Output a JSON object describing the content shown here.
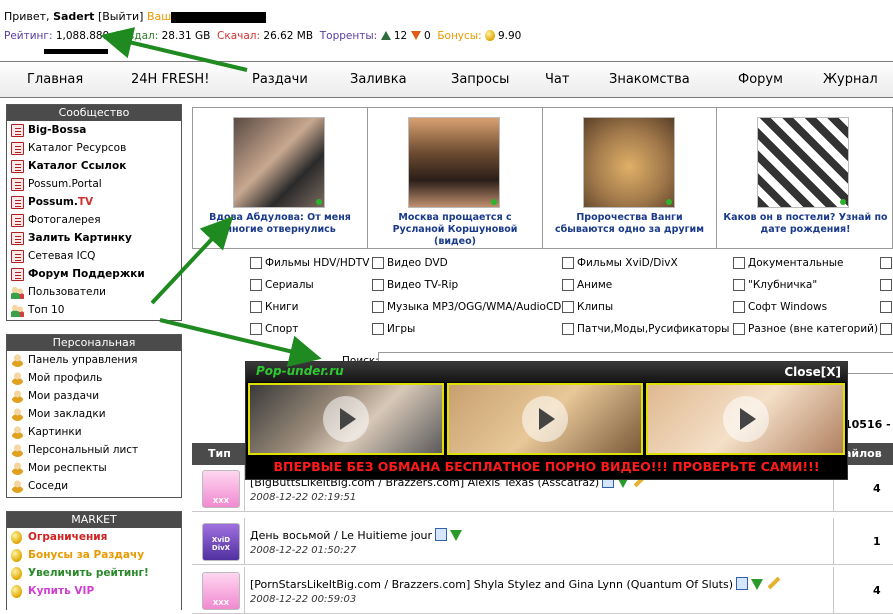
{
  "userbar": {
    "greeting": "Привет,",
    "username": "Sadert",
    "logout": "[Выйти]",
    "your_label": "Ваш",
    "rating_label": "Рейтинг:",
    "rating_value": "1,088.889",
    "upload_label": "Роздал:",
    "upload_value": "28.31 GB",
    "download_label": "Скачал:",
    "download_value": "26.62 MB",
    "torrents_label": "Торренты:",
    "seeding": "12",
    "leeching": "0",
    "bonus_label": "Бонусы:",
    "bonus_value": "9.90"
  },
  "nav": [
    {
      "label": "Главная"
    },
    {
      "label": "24H FRESH!"
    },
    {
      "label": "Раздачи"
    },
    {
      "label": "Заливка"
    },
    {
      "label": "Запросы"
    },
    {
      "label": "Чат"
    },
    {
      "label": "Знакомства"
    },
    {
      "label": "Форум"
    },
    {
      "label": "Журнал"
    }
  ],
  "community": {
    "title": "Сообщество",
    "items": [
      {
        "label": "Big-Bossa",
        "icon": "doc-icon"
      },
      {
        "label": "Каталог Ресурсов",
        "icon": "doc-icon"
      },
      {
        "label": "Каталог Ссылок",
        "icon": "doc-icon"
      },
      {
        "label": "Possum.Portal",
        "icon": "doc-icon"
      },
      {
        "label": "Possum.",
        "label_suffix": "TV",
        "icon": "doc-icon"
      },
      {
        "label": "Фотогалерея",
        "icon": "doc-icon"
      },
      {
        "label": "Залить Картинку",
        "icon": "doc-icon"
      },
      {
        "label": "Сетевая ICQ",
        "icon": "doc-icon"
      },
      {
        "label": "Форум Поддержки",
        "icon": "doc-icon"
      },
      {
        "label": "Пользователи",
        "icon": "users-icon"
      },
      {
        "label": "Топ 10",
        "icon": "users-icon"
      }
    ]
  },
  "personal": {
    "title": "Персональная",
    "items": [
      {
        "label": "Панель управления"
      },
      {
        "label": "Мой профиль"
      },
      {
        "label": "Мои раздачи"
      },
      {
        "label": "Мои закладки"
      },
      {
        "label": "Картинки"
      },
      {
        "label": "Персональный лист"
      },
      {
        "label": "Мои респекты"
      },
      {
        "label": "Соседи"
      }
    ]
  },
  "market": {
    "title": "MARKET",
    "items": [
      {
        "label": "Ограничения",
        "color": "#d02020"
      },
      {
        "label": "Бонусы за Раздачу",
        "color": "#e89a00"
      },
      {
        "label": "Увеличить рейтинг!",
        "color": "#2a8a2a"
      },
      {
        "label": "Купить VIP",
        "color": "#d040d0"
      }
    ]
  },
  "featured": [
    {
      "caption": "Вдова Абдулова: От меня многие отвернулись"
    },
    {
      "caption": "Москва прощается с Русланой Коршуновой (видео)"
    },
    {
      "caption": "Пророчества Ванги сбываются одно за другим"
    },
    {
      "caption": "Каков он в постели? Узнай по дате рождения!"
    }
  ],
  "categories": [
    [
      "Фильмы HDV/HDTV",
      "Видео DVD",
      "Фильмы XviD/DivX",
      "Документальные"
    ],
    [
      "Сериалы",
      "Видео TV-Rip",
      "Аниме",
      "\"Клубничка\""
    ],
    [
      "Книги",
      "Музыка MP3/OGG/WMA/AudioCD",
      "Клипы",
      "Софт Windows"
    ],
    [
      "Спорт",
      "Игры",
      "Патчи,Моды,Русификаторы",
      "Разное (вне категорий)"
    ]
  ],
  "search": {
    "label": "Поиск:",
    "placeholder": ""
  },
  "pager": "10516 -",
  "table": {
    "col_type": "Тип",
    "col_files": "айлов",
    "rows": [
      {
        "type": "xxx",
        "title": "[BigButtsLikeItBig.com / Brazzers.com] Alexis Texas (Asscatraz)",
        "date": "2008-12-22 02:19:51",
        "count": "4"
      },
      {
        "type": "xvid",
        "title": "День восьмой / Le Huitieme jour",
        "date": "2008-12-22 01:50:27",
        "count": "1"
      },
      {
        "type": "xxx",
        "title": "[PornStarsLikeItBig.com / Brazzers.com] Shyla Stylez and Gina Lynn (Quantum Of Sluts)",
        "date": "2008-12-22 00:59:03",
        "count": "4"
      }
    ]
  },
  "popup": {
    "brand": "Pop-under.ru",
    "close": "Close[X]",
    "message": "ВПЕРВЫЕ БЕЗ ОБМАНА БЕСПЛАТНОЕ ПОРНО ВИДЕО!!! ПРОВЕРЬТЕ САМИ!!!"
  },
  "colors": {
    "sidebar_header": "#4b4b4b",
    "link_blue": "#1a3a8a",
    "annotation_arrow": "#1f8a1f",
    "popup_text": "#ff1a1a",
    "popup_brand": "#2ec830"
  }
}
